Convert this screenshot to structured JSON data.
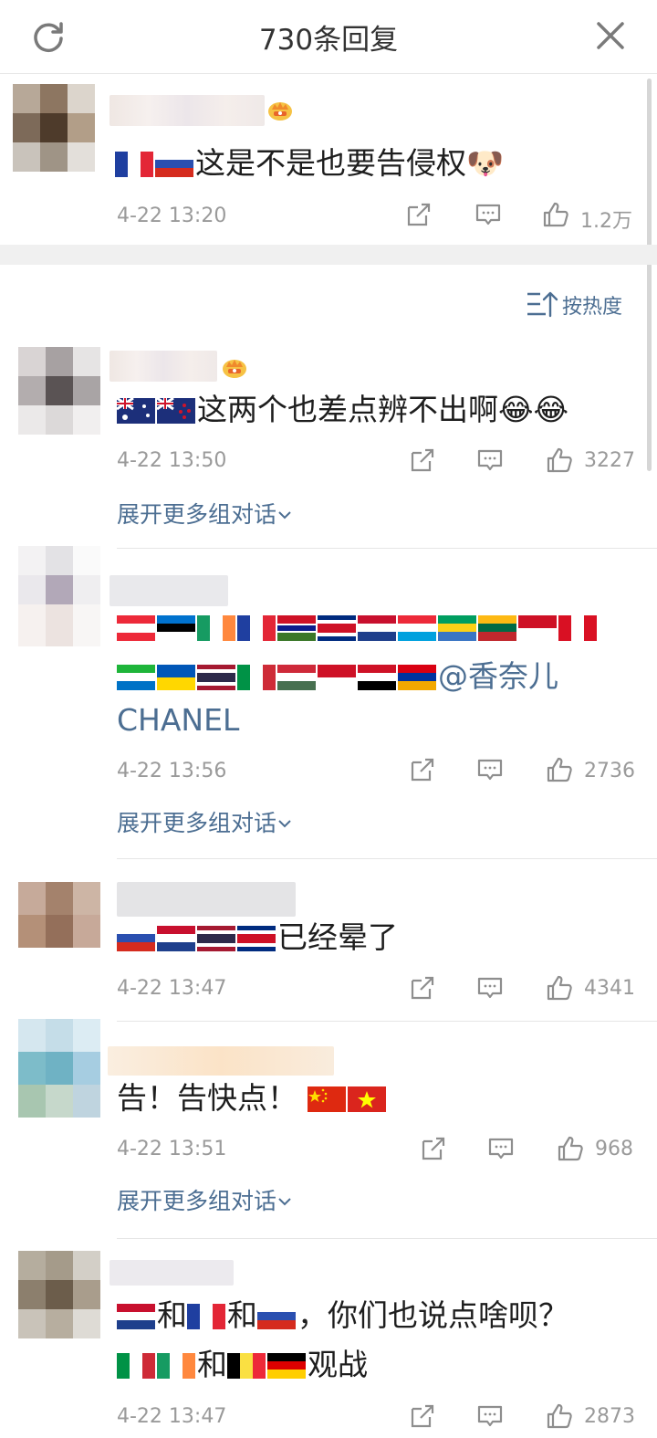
{
  "header": {
    "title": "730条回复"
  },
  "top_comment": {
    "text": "这是不是也要告侵权",
    "time": "4-22 13:20",
    "likes": "1.2万"
  },
  "sort": {
    "label": "按热度"
  },
  "comments": [
    {
      "text": "这两个也差点辨不出啊",
      "time": "4-22 13:50",
      "likes": "3227",
      "expand": "展开更多组对话"
    },
    {
      "text_mention": "@香奈儿",
      "text_line3": "CHANEL",
      "time": "4-22 13:56",
      "likes": "2736",
      "expand": "展开更多组对话"
    },
    {
      "text": "已经晕了",
      "time": "4-22 13:47",
      "likes": "4341"
    },
    {
      "text": "告！告快点！",
      "time": "4-22 13:51",
      "likes": "968",
      "expand": "展开更多组对话"
    },
    {
      "text_a": "和",
      "text_b": "和",
      "text_c": "，你们也说点啥呗？",
      "text_d": "和",
      "text_e": "观战",
      "time": "4-22 13:47",
      "likes": "2873"
    }
  ],
  "icons": {
    "refresh": "refresh-icon",
    "close": "close-icon",
    "share": "share-icon",
    "comment": "comment-icon",
    "like": "like-icon",
    "sort": "sort-icon",
    "crown": "crown-icon",
    "chevron": "chevron-down-icon"
  },
  "colors": {
    "link": "#4c6e92",
    "meta": "#9a9a9a",
    "divider": "#f0f0f0"
  }
}
